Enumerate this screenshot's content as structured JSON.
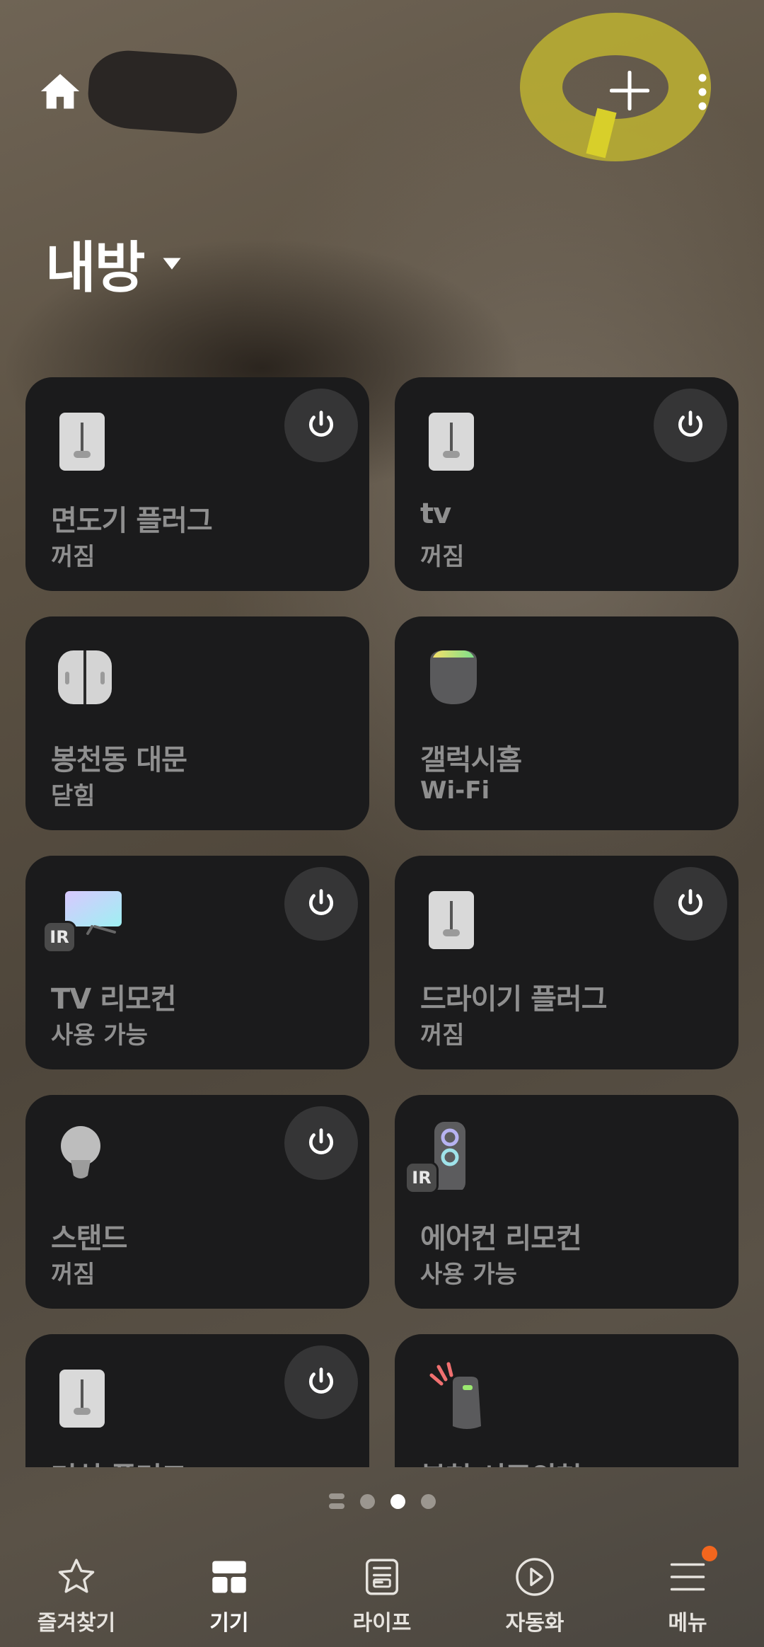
{
  "header": {
    "home_icon": "home-icon",
    "add_icon": "plus-icon",
    "more_icon": "more-vertical-icon"
  },
  "room": {
    "title": "내방",
    "dropdown_icon": "caret-down-icon"
  },
  "devices": [
    {
      "name": "면도기 플러그",
      "status": "꺼짐",
      "icon": "smart-plug-icon",
      "power_button": true
    },
    {
      "name": "tv",
      "status": "꺼짐",
      "icon": "smart-plug-icon",
      "power_button": true
    },
    {
      "name": "봉천동 대문",
      "status": "닫힘",
      "icon": "door-sensor-icon",
      "power_button": false
    },
    {
      "name": "갤럭시홈",
      "status": "Wi-Fi",
      "icon": "speaker-icon",
      "power_button": false
    },
    {
      "name": "TV 리모컨",
      "status": "사용 가능",
      "icon": "tv-ir-remote-icon",
      "power_button": true,
      "badge": "IR"
    },
    {
      "name": "드라이기 플러그",
      "status": "꺼짐",
      "icon": "smart-plug-icon",
      "power_button": true
    },
    {
      "name": "스탠드",
      "status": "꺼짐",
      "icon": "light-bulb-icon",
      "power_button": true
    },
    {
      "name": "에어컨 리모컨",
      "status": "사용 가능",
      "icon": "ac-ir-remote-icon",
      "power_button": false,
      "badge": "IR"
    },
    {
      "name": "거실 플러그",
      "status": "",
      "icon": "smart-plug-icon",
      "power_button": true
    },
    {
      "name": "봉천 셔주의천",
      "status": "",
      "icon": "smart-speaker-alert-icon",
      "power_button": false
    }
  ],
  "pagination": {
    "pages": 3,
    "active_index": 1
  },
  "bottom_nav": [
    {
      "label": "즐겨찾기",
      "icon": "star-icon",
      "active": false
    },
    {
      "label": "기기",
      "icon": "devices-grid-icon",
      "active": true
    },
    {
      "label": "라이프",
      "icon": "life-icon",
      "active": false
    },
    {
      "label": "자동화",
      "icon": "play-circle-icon",
      "active": false
    },
    {
      "label": "메뉴",
      "icon": "menu-icon",
      "active": false,
      "notification": true
    }
  ],
  "colors": {
    "card_bg": "#1b1b1c",
    "power_bg": "#353536",
    "notification": "#f2661e"
  }
}
